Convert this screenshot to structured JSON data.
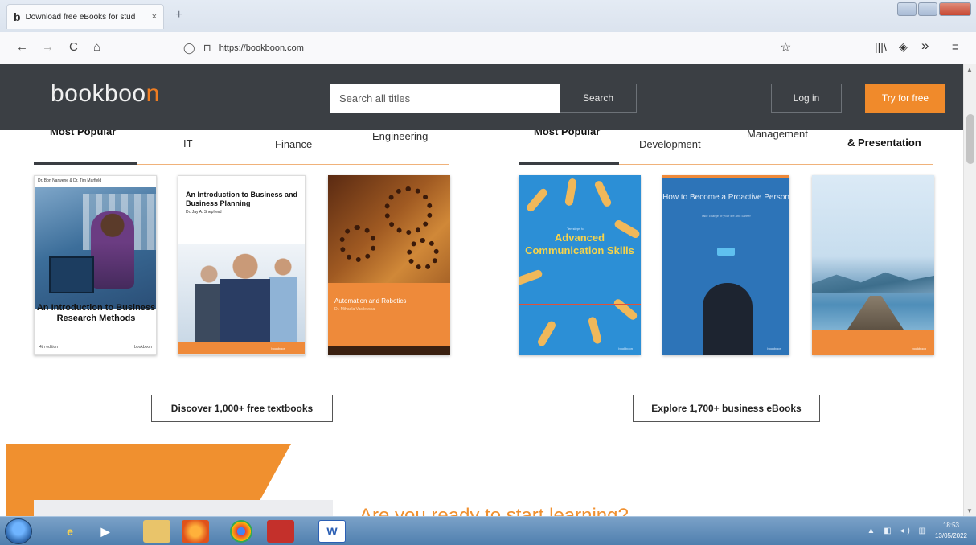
{
  "browser": {
    "tab_title": "Download free eBooks for stud",
    "tab_favicon": "b",
    "tab_close": "×",
    "new_tab": "+",
    "url": "https://bookboon.com",
    "nav": {
      "back": "←",
      "forward": "→",
      "reload": "C",
      "home": "⌂"
    },
    "toolbar_right": {
      "library": "|||\\",
      "pocket": "◈",
      "overflow": "»",
      "menu": "≡"
    }
  },
  "header": {
    "logo_main": "bookboo",
    "logo_accent": "n",
    "search_placeholder": "Search all titles",
    "search_button": "Search",
    "login_button": "Log in",
    "try_button": "Try for free"
  },
  "categories_left": [
    "Most Popular",
    "IT",
    "Finance",
    "Engineering"
  ],
  "categories_right": [
    "Most Popular",
    "Development",
    "Management",
    "& Presentation"
  ],
  "books": {
    "b1": {
      "authors": "Dr. Bon Narwene & Dr. Tim Marfield",
      "title": "An Introduction to Business Research Methods",
      "publisher_left": "4th edition",
      "publisher_right": "bookboon"
    },
    "b2": {
      "title": "An Introduction to Business and Business Planning",
      "author": "Dr. Jay A. Shepherd",
      "publisher": "bookboon"
    },
    "b3": {
      "title": "Automation and Robotics",
      "subtitle": "Dr. Mihaela Vasilevska",
      "publisher": "bookboon"
    },
    "b4": {
      "prefix": "Ten steps to",
      "title": "Advanced Communication Skills",
      "publisher": "bookboon"
    },
    "b5": {
      "title": "How to Become a Proactive Person",
      "subtitle": "Take charge of your life and career",
      "publisher": "bookboon"
    },
    "b6": {
      "publisher": "bookboon"
    }
  },
  "discover_button": "Discover 1,000+ free textbooks",
  "explore_button": "Explore 1,700+ business eBooks",
  "cta_heading": "Are you ready to start learning?",
  "taskbar": {
    "word_label": "W",
    "tray": "▲ ◧ ◂) ▥",
    "time": "18:53",
    "date": "13/05/2022"
  },
  "colors": {
    "brand_orange": "#f08a2b",
    "header_bg": "#3b3f44",
    "cover_blue": "#2c8fd6"
  }
}
